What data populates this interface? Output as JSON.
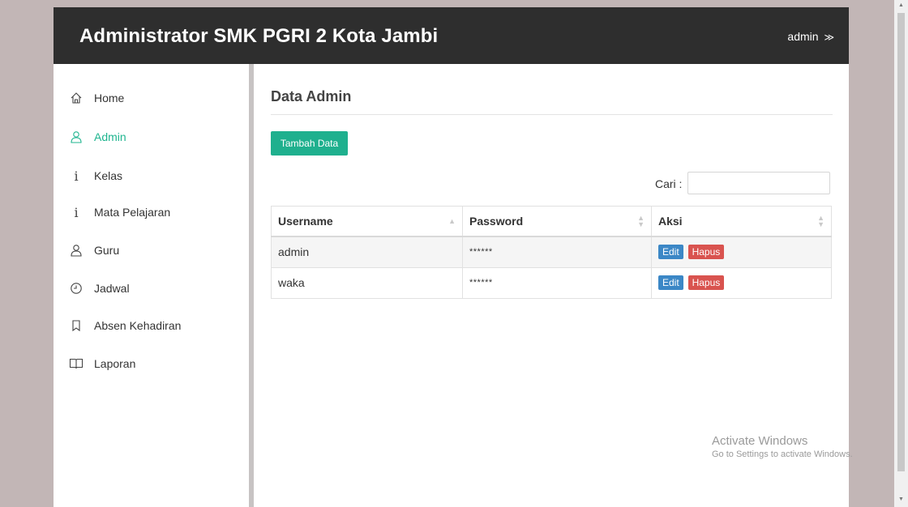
{
  "header": {
    "title": "Administrator SMK PGRI 2 Kota Jambi",
    "user": "admin",
    "user_chevron": "≫"
  },
  "sidebar": {
    "items": [
      {
        "label": "Home",
        "icon": "home-icon",
        "active": false
      },
      {
        "label": "Admin",
        "icon": "user-icon",
        "active": true
      },
      {
        "label": "Kelas",
        "icon": "info-icon",
        "active": false
      },
      {
        "label": "Mata Pelajaran",
        "icon": "info-icon",
        "active": false
      },
      {
        "label": "Guru",
        "icon": "user-icon",
        "active": false
      },
      {
        "label": "Jadwal",
        "icon": "clock-icon",
        "active": false
      },
      {
        "label": "Absen Kehadiran",
        "icon": "bookmark-icon",
        "active": false
      },
      {
        "label": "Laporan",
        "icon": "book-icon",
        "active": false
      }
    ]
  },
  "main": {
    "title": "Data Admin",
    "add_button": "Tambah Data",
    "search_label": "Cari :",
    "search_value": ""
  },
  "table": {
    "columns": [
      "Username",
      "Password",
      "Aksi"
    ],
    "rows": [
      {
        "username": "admin",
        "password": "******",
        "edit": "Edit",
        "delete": "Hapus"
      },
      {
        "username": "waka",
        "password": "******",
        "edit": "Edit",
        "delete": "Hapus"
      }
    ]
  },
  "watermark": {
    "line1": "Activate Windows",
    "line2": "Go to Settings to activate Windows."
  },
  "colors": {
    "accent": "#1fb08e",
    "header_bg": "#2e2e2e",
    "edit": "#3b87c6",
    "delete": "#d9534f"
  }
}
